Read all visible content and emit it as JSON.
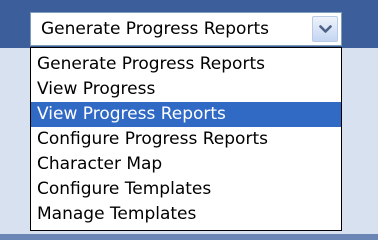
{
  "dropdown": {
    "selected_value": "Generate Progress Reports",
    "arrow_icon": "chevron-down-icon",
    "highlighted_index": 2,
    "highlight_color": "#316ac5",
    "options": [
      "Generate Progress Reports",
      "View Progress",
      "View Progress Reports",
      "Configure Progress Reports",
      "Character Map",
      "Configure Templates",
      "Manage Templates"
    ]
  }
}
